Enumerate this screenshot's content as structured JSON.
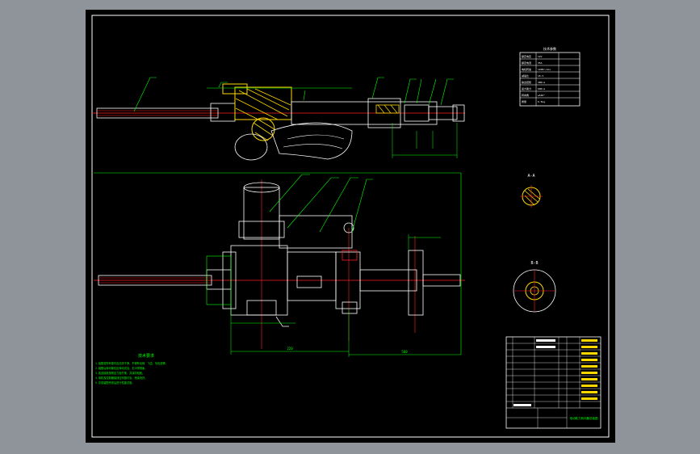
{
  "drawing": {
    "notes_title": "技术要求",
    "notes": [
      "1.装配前所有零件应清洗干净，不得有毛刺、飞边、氧化皮等。",
      "2.装配后转向管柱应转动灵活，无卡滞现象。",
      "3.各连接处按规定力矩拧紧，并涂防松胶。",
      "4.电机及控制器接线应牢固可靠，绝缘良好。",
      "5.总成装配完成后进行性能试验。"
    ],
    "param_table": {
      "title": "技术参数",
      "rows": [
        [
          "额定电压",
          "12V"
        ],
        [
          "额定电流",
          "35A"
        ],
        [
          "电机转速",
          "1200r/min"
        ],
        [
          "减速比",
          "16.5"
        ],
        [
          "输出扭矩",
          "40N·m"
        ],
        [
          "最大助力",
          "60N·m"
        ],
        [
          "转向角",
          "±540°"
        ],
        [
          "质量",
          "6.5kg"
        ]
      ]
    },
    "section_labels": [
      "A-A",
      "B-B"
    ],
    "dim_labels": [
      "220",
      "580"
    ],
    "title_block": {
      "title": "电动助力转向器总装图"
    }
  },
  "colors": {
    "background": "#8f939a",
    "sheet": "#000000",
    "border": "#ffffff",
    "part": "#ffffff",
    "centerline": "#ff2020",
    "dimension": "#00ff00",
    "hatch": "#ffd800",
    "leader": "#00ff00"
  }
}
